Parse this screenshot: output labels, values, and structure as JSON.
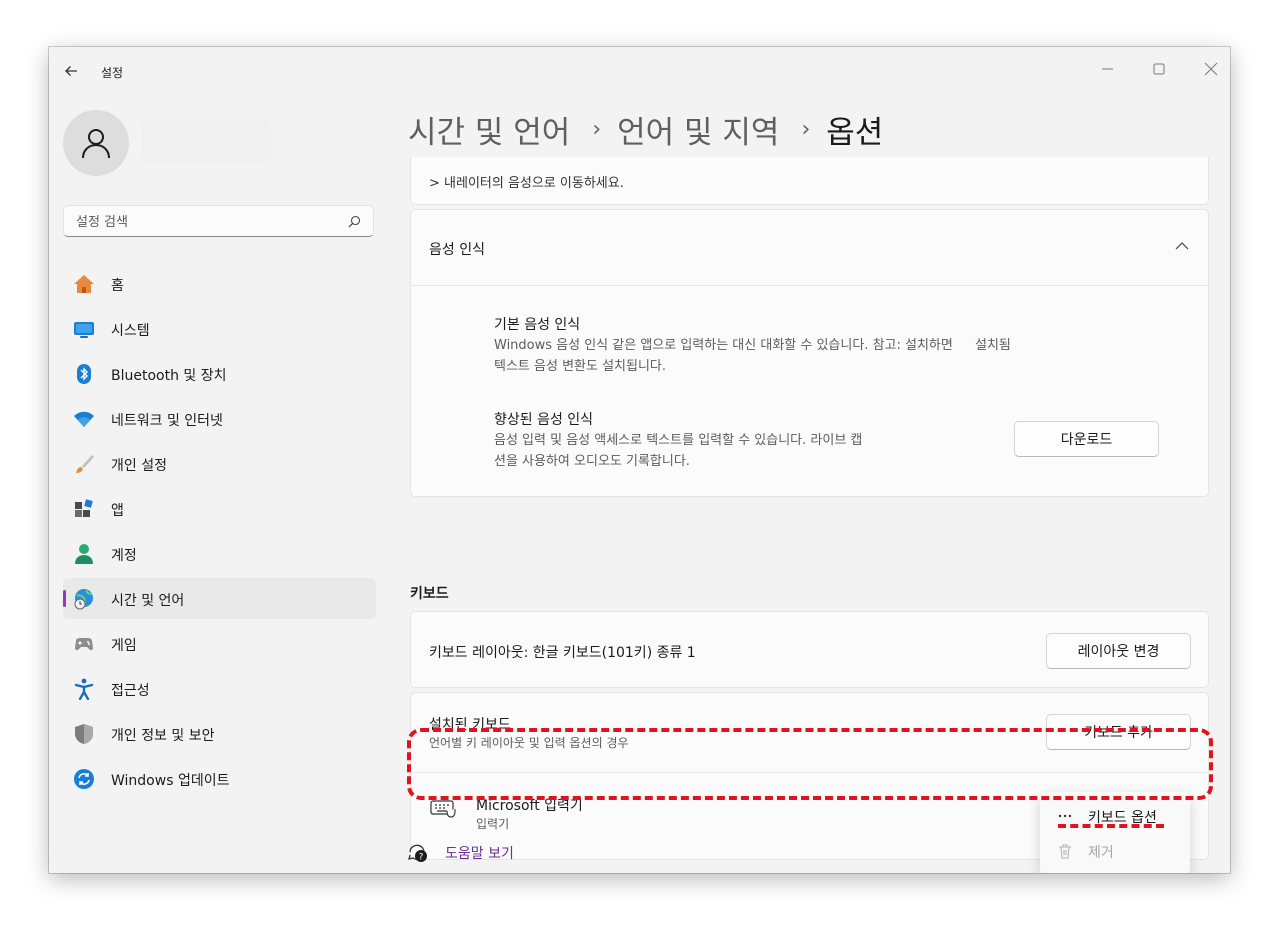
{
  "app": {
    "title": "설정",
    "back_icon": "arrow-left-icon",
    "window_controls": [
      "minimize-icon",
      "maximize-icon",
      "close-icon"
    ]
  },
  "user": {
    "avatar_icon": "person-icon"
  },
  "search": {
    "placeholder": "설정 검색",
    "icon": "search-icon"
  },
  "nav": {
    "items": [
      {
        "label": "홈",
        "icon": "home-icon"
      },
      {
        "label": "시스템",
        "icon": "monitor-icon"
      },
      {
        "label": "Bluetooth 및 장치",
        "icon": "bluetooth-icon"
      },
      {
        "label": "네트워크 및 인터넷",
        "icon": "wifi-icon"
      },
      {
        "label": "개인 설정",
        "icon": "brush-icon"
      },
      {
        "label": "앱",
        "icon": "apps-icon"
      },
      {
        "label": "계정",
        "icon": "account-icon"
      },
      {
        "label": "시간 및 언어",
        "icon": "globe-clock-icon",
        "active": true
      },
      {
        "label": "게임",
        "icon": "gamepad-icon"
      },
      {
        "label": "접근성",
        "icon": "accessibility-icon"
      },
      {
        "label": "개인 정보 및 보안",
        "icon": "shield-icon"
      },
      {
        "label": "Windows 업데이트",
        "icon": "update-icon"
      }
    ],
    "accent_color": "#8a3fb0"
  },
  "breadcrumb": {
    "items": [
      "시간 및 언어",
      "언어 및 지역",
      "옵션"
    ],
    "separator": "›"
  },
  "narrator_note": "> 내레이터의 음성으로 이동하세요.",
  "speech": {
    "title": "음성 인식",
    "basic": {
      "title": "기본 음성 인식",
      "desc_line1": "Windows 음성 인식 같은 앱으로 입력하는 대신 대화할 수 있습니다. 참고: 설치하면",
      "desc_suffix": "설치됨",
      "desc_line2": "텍스트 음성 변환도 설치됩니다."
    },
    "enhanced": {
      "title": "향상된 음성 인식",
      "desc_line1": "음성 입력 및 음성 액세스로 텍스트를 입력할 수 있습니다. 라이브 캡",
      "desc_line2": "션을 사용하여 오디오도 기록합니다.",
      "button": "다운로드"
    }
  },
  "keyboard": {
    "section_title": "키보드",
    "layout_label": "키보드 레이아웃: 한글 키보드(101키) 종류 1",
    "layout_button": "레이아웃 변경",
    "installed_title": "설치된 키보드",
    "installed_desc": "언어별 키 레이아웃 및 입력 옵션의 경우",
    "add_button": "키보드 추가",
    "ime": {
      "name": "Microsoft 입력기",
      "sub": "입력기",
      "icon": "keyboard-icon",
      "more": "···"
    }
  },
  "help": {
    "label": "도움말 보기",
    "icon": "help-icon"
  },
  "context_menu": {
    "items": [
      {
        "label": "키보드 옵션",
        "icon": "more-icon",
        "enabled": true
      },
      {
        "label": "제거",
        "icon": "trash-icon",
        "enabled": false
      }
    ]
  },
  "annotation_color": "#e0141b"
}
